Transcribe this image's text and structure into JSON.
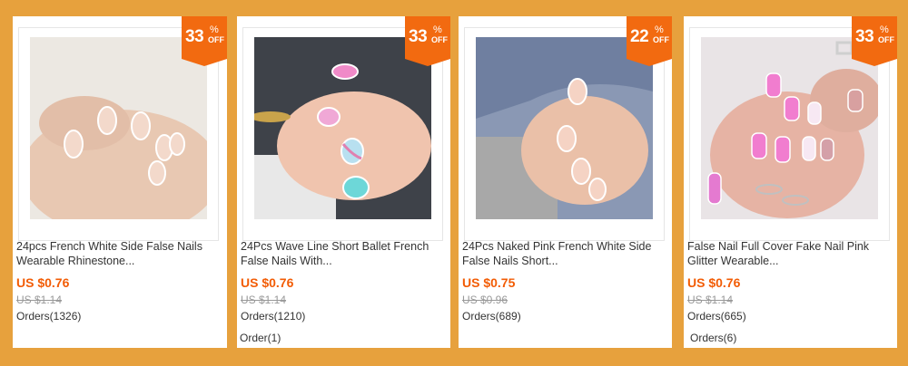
{
  "theme": {
    "background": "#e7a13d",
    "badge_color": "#f26a10",
    "price_color": "#f25c05"
  },
  "products": [
    {
      "image_icon": "nails-photo",
      "discount": "33",
      "discount_symbol": "%",
      "discount_suffix": "OFF",
      "title": "24pcs French White Side False Nails\nWearable Rhinestone...",
      "price": "US $0.76",
      "original_price": "US $1.14",
      "orders": "Orders(1326)",
      "extra": ""
    },
    {
      "image_icon": "nails-photo",
      "discount": "33",
      "discount_symbol": "%",
      "discount_suffix": "OFF",
      "title": "24Pcs Wave Line Short Ballet French\nFalse Nails With...",
      "price": "US $0.76",
      "original_price": "US $1.14",
      "orders": "Orders(1210)",
      "extra": "Order(1)"
    },
    {
      "image_icon": "nails-photo",
      "discount": "22",
      "discount_symbol": "%",
      "discount_suffix": "OFF",
      "title": "24Pcs Naked Pink French White Side\nFalse Nails Short...",
      "price": "US $0.75",
      "original_price": "US $0.96",
      "orders": "Orders(689)",
      "extra": ""
    },
    {
      "image_icon": "nails-photo",
      "discount": "33",
      "discount_symbol": "%",
      "discount_suffix": "OFF",
      "title": "False Nail Full Cover Fake Nail Pink\nGlitter Wearable...",
      "price": "US $0.76",
      "original_price": "US $1.14",
      "orders": "Orders(665)",
      "extra": "Orders(6)"
    }
  ]
}
